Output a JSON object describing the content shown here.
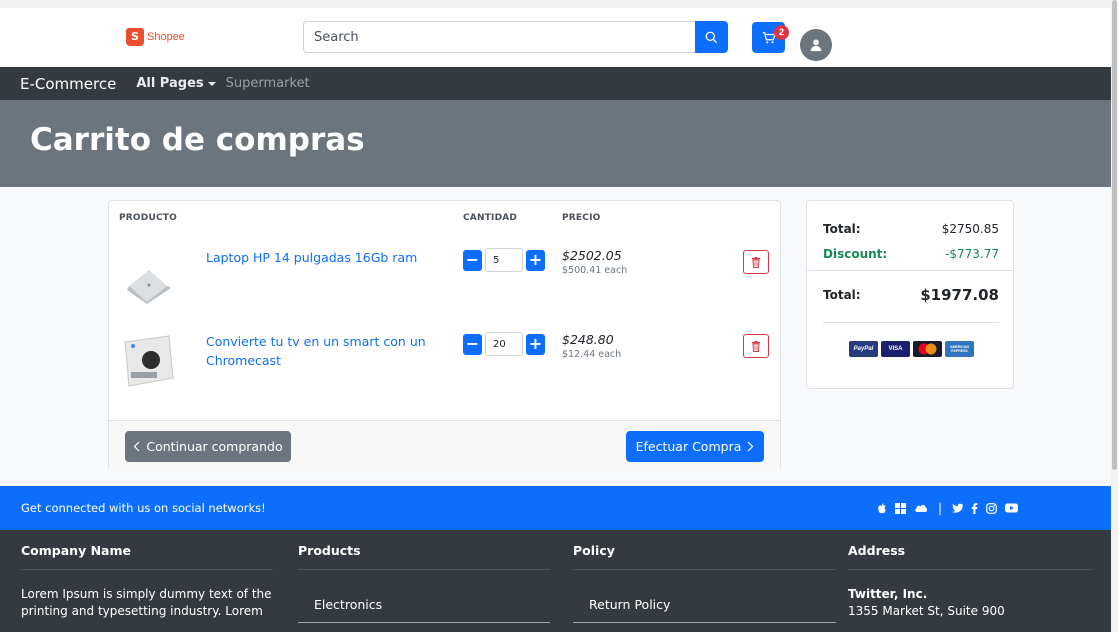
{
  "header": {
    "logo_text": "Shopee",
    "logo_letter": "S",
    "search_placeholder": "Search",
    "cart_count": "2"
  },
  "navbar": {
    "brand": "E-Commerce",
    "links": [
      {
        "label": "All Pages"
      },
      {
        "label": "Supermarket"
      }
    ]
  },
  "hero": {
    "title": "Carrito de compras"
  },
  "cart": {
    "columns": {
      "product": "PRODUCTO",
      "quantity": "CANTIDAD",
      "price": "PRECIO"
    },
    "items": [
      {
        "name": "Laptop HP 14 pulgadas 16Gb ram",
        "qty": "5",
        "total": "$2502.05",
        "each": "$500.41 each"
      },
      {
        "name": "Convierte tu tv en un smart con un Chromecast",
        "qty": "20",
        "total": "$248.80",
        "each": "$12.44 each"
      }
    ],
    "continue_label": "Continuar comprando",
    "checkout_label": "Efectuar Compra"
  },
  "summary": {
    "total_label": "Total:",
    "total_value": "$2750.85",
    "discount_label": "Discount:",
    "discount_value": "-$773.77",
    "grand_label": "Total:",
    "grand_value": "$1977.08",
    "payment_methods": [
      "PayPal",
      "VISA",
      "mastercard",
      "AMERICAN EXPRESS"
    ]
  },
  "social": {
    "text": "Get connected with us on social networks!",
    "icons": [
      "apple-icon",
      "windows-icon",
      "cloud-icon",
      "twitter-icon",
      "facebook-icon",
      "instagram-icon",
      "youtube-icon"
    ]
  },
  "footer": {
    "company": {
      "heading": "Company Name",
      "text": "Lorem Ipsum is simply dummy text of the printing and typesetting industry. Lorem"
    },
    "products": {
      "heading": "Products",
      "link": "Electronics"
    },
    "policy": {
      "heading": "Policy",
      "link": "Return Policy"
    },
    "address": {
      "heading": "Address",
      "name": "Twitter, Inc.",
      "line1": "1355 Market St, Suite 900"
    }
  },
  "colors": {
    "primary": "#0d6efd",
    "dark": "#343a40",
    "secondary": "#6c757d",
    "danger": "#dc3545",
    "success": "#198754",
    "shopee": "#ee4d2d"
  }
}
